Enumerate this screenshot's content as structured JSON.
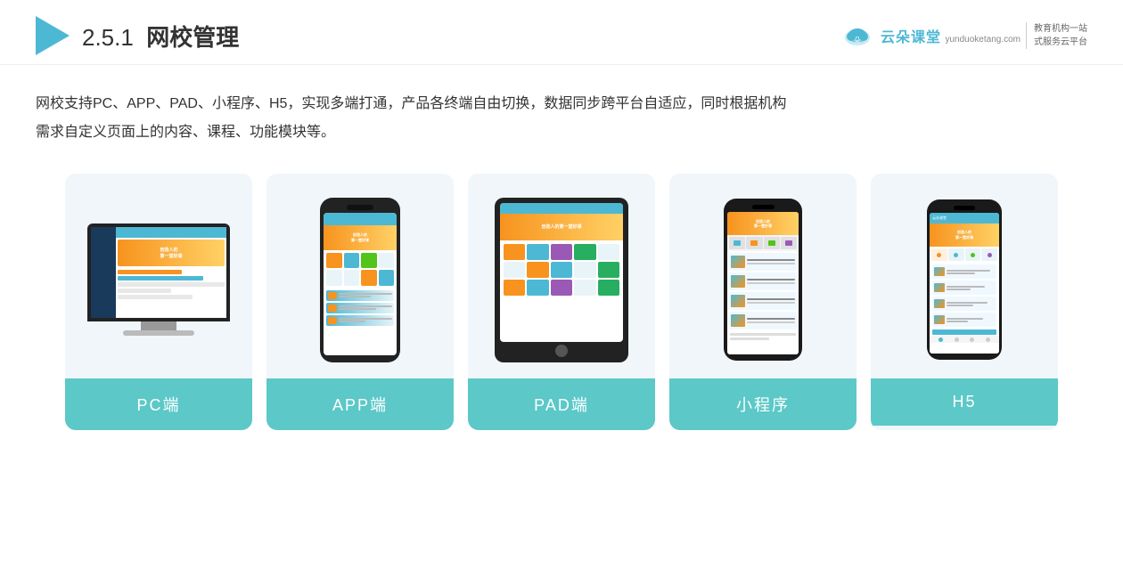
{
  "header": {
    "section_number": "2.5.1",
    "title_bold": "网校管理",
    "logo_text": "云朵课堂",
    "logo_domain": "yunduoketang.com",
    "logo_slogan_line1": "教育机构一站",
    "logo_slogan_line2": "式服务云平台"
  },
  "description": {
    "line1": "网校支持PC、APP、PAD、小程序、H5，实现多端打通，产品各终端自由切换，数据同步跨平台自适应，同时根据机构",
    "line2": "需求自定义页面上的内容、课程、功能模块等。"
  },
  "cards": [
    {
      "id": "pc",
      "label": "PC端"
    },
    {
      "id": "app",
      "label": "APP端"
    },
    {
      "id": "pad",
      "label": "PAD端"
    },
    {
      "id": "miniprogram",
      "label": "小程序"
    },
    {
      "id": "h5",
      "label": "H5"
    }
  ]
}
